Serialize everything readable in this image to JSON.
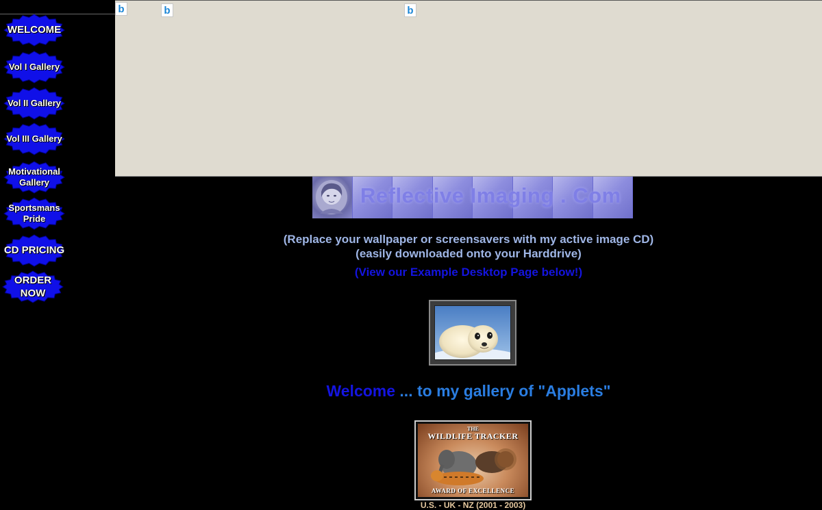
{
  "nav": {
    "items": [
      {
        "label": "WELCOME"
      },
      {
        "label": "Vol I Gallery"
      },
      {
        "label": "Vol II Gallery"
      },
      {
        "label": "Vol III Gallery"
      },
      {
        "label": "Motivational\nGallery"
      },
      {
        "label": "Sportsmans\nPride"
      },
      {
        "label": "CD PRICING"
      },
      {
        "label": "ORDER\nNOW"
      }
    ]
  },
  "panel": {
    "icons": [
      "bing-icon",
      "bing-icon",
      "bing-icon"
    ],
    "icon_glyph": "b"
  },
  "banner": {
    "title": "Reflective Imaging . Com"
  },
  "intro": {
    "line1": "(Replace your wallpaper or screensavers with my active image CD)",
    "line2": "(easily downloaded onto your Harddrive)",
    "line3": "(View our Example Desktop Page below!)"
  },
  "welcome": {
    "part1": "Welcome",
    "part2": "... to my gallery of",
    "part3": "\"Applets\""
  },
  "award": {
    "the": "THE",
    "title": "WILDLIFE TRACKER",
    "subtitle": "AWARD OF EXCELLENCE",
    "caption": "U.S. - UK - NZ (2001 - 2003)"
  },
  "colors": {
    "background": "#000000",
    "panel": "#dfdbd0",
    "star_blue": "#1010e8",
    "welcome_dark": "#1414e0",
    "welcome_light": "#2a7de1"
  }
}
